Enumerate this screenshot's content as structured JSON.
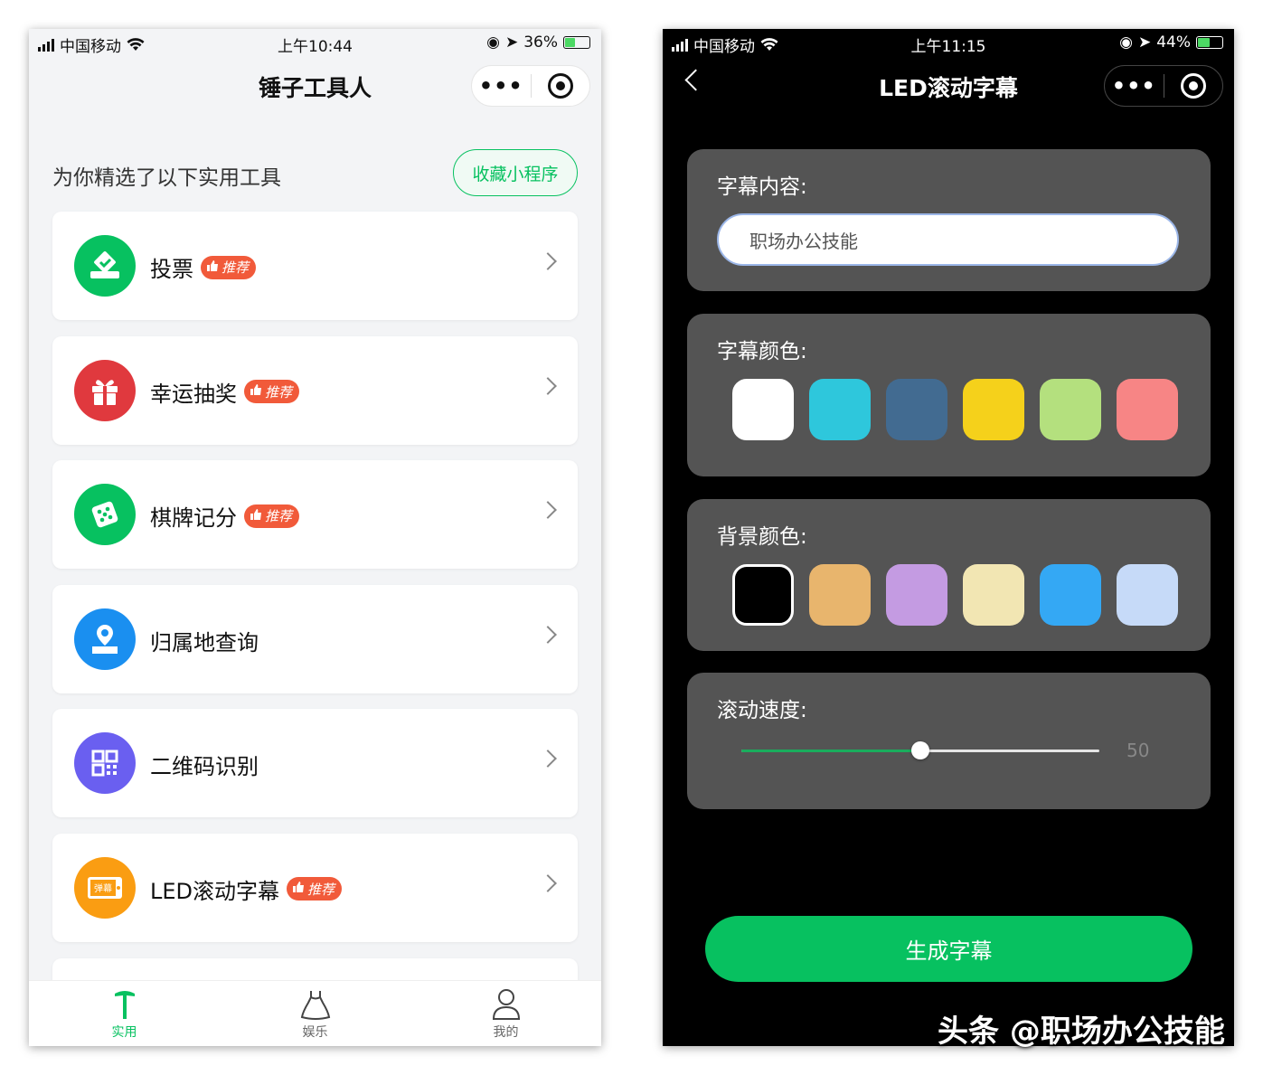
{
  "left_screen": {
    "status": {
      "carrier": "中国移动",
      "time": "上午10:44",
      "battery": "36%"
    },
    "nav": {
      "title": "锤子工具人",
      "more": "•••"
    },
    "section_title": "为你精选了以下实用工具",
    "favorite_label": "收藏小程序",
    "badge_label": "推荐",
    "tools": [
      {
        "label": "投票",
        "recommended": true,
        "icon": "vote-icon",
        "color": "#07c160"
      },
      {
        "label": "幸运抽奖",
        "recommended": true,
        "icon": "gift-icon",
        "color": "#e0393e"
      },
      {
        "label": "棋牌记分",
        "recommended": true,
        "icon": "dice-icon",
        "color": "#07c160"
      },
      {
        "label": "归属地查询",
        "recommended": false,
        "icon": "location-icon",
        "color": "#1a8ff0"
      },
      {
        "label": "二维码识别",
        "recommended": false,
        "icon": "qrcode-icon",
        "color": "#6a5ff0"
      },
      {
        "label": "LED滚动字幕",
        "recommended": true,
        "icon": "led-icon",
        "color": "#fa9d12",
        "icon_text": "弹幕"
      }
    ],
    "tabs": [
      {
        "label": "实用",
        "icon": "hammer-icon",
        "active": true
      },
      {
        "label": "娱乐",
        "icon": "dress-icon",
        "active": false
      },
      {
        "label": "我的",
        "icon": "user-icon",
        "active": false
      }
    ]
  },
  "right_screen": {
    "status": {
      "carrier": "中国移动",
      "time": "上午11:15",
      "battery": "44%"
    },
    "nav": {
      "title": "LED滚动字幕",
      "more": "•••"
    },
    "caption": {
      "label": "字幕内容:",
      "value": "职场办公技能"
    },
    "text_color": {
      "label": "字幕颜色:",
      "options": [
        "#ffffff",
        "#2ec7dc",
        "#426b91",
        "#f5d11b",
        "#b4e07e",
        "#f78585"
      ],
      "selected": 0
    },
    "background_color": {
      "label": "背景颜色:",
      "options": [
        "#000000",
        "#e8b56d",
        "#c49be2",
        "#f2e6b3",
        "#34a8f4",
        "#c6daf8"
      ],
      "selected": 0
    },
    "speed": {
      "label": "滚动速度:",
      "value": 50,
      "min": 0,
      "max": 100
    },
    "generate_label": "生成字幕"
  },
  "watermark": "头条 @职场办公技能"
}
